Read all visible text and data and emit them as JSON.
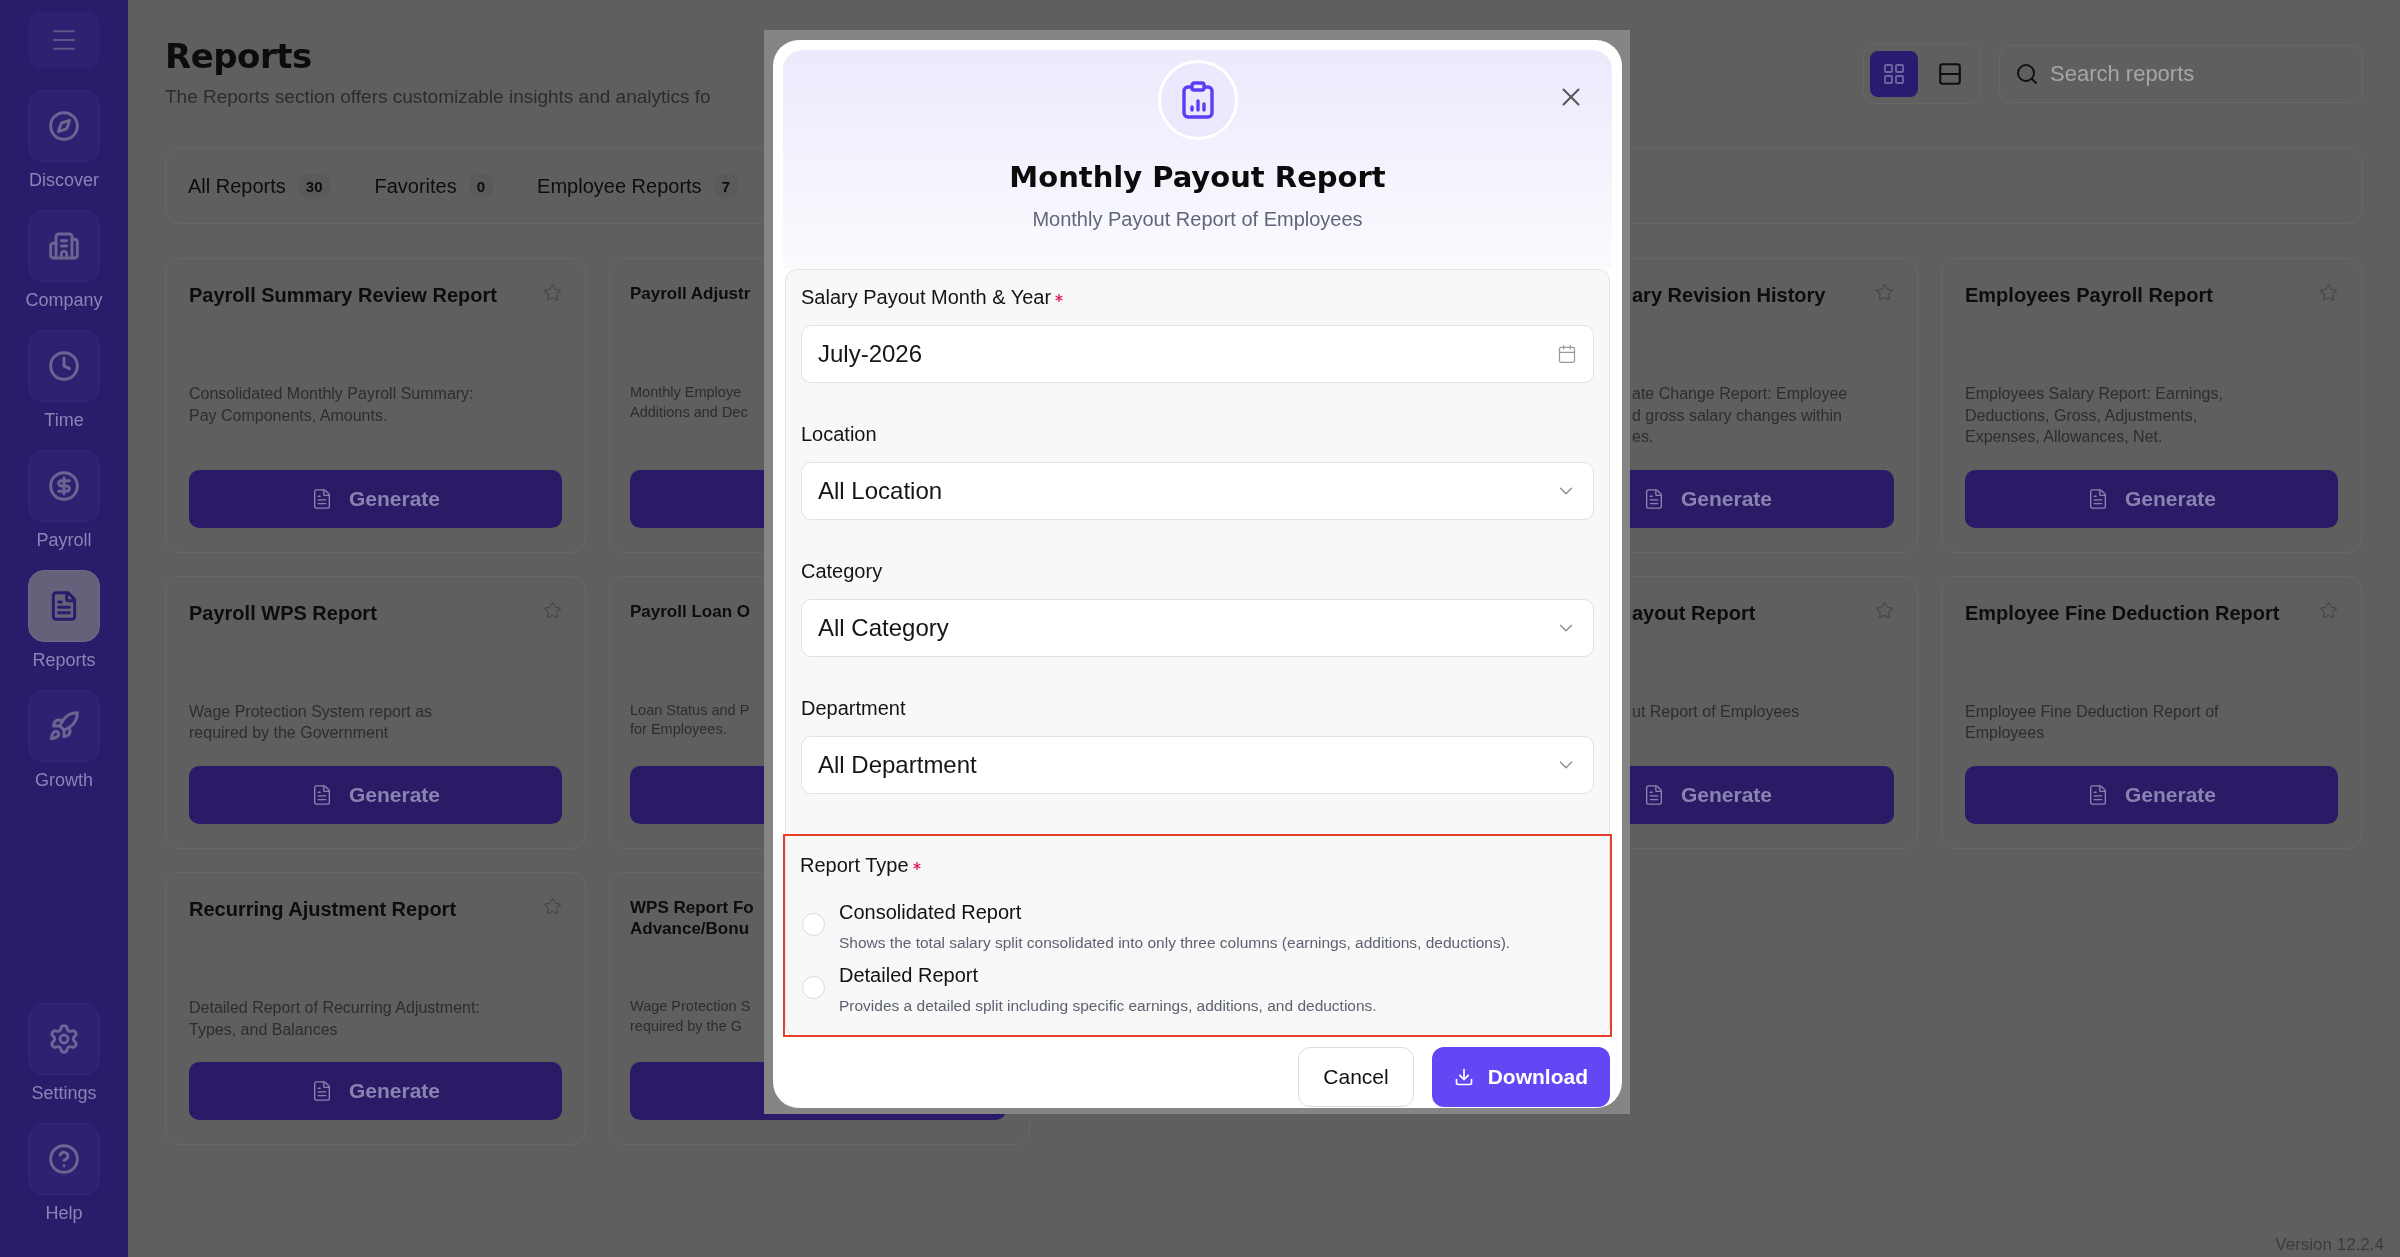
{
  "sidebar": {
    "items": [
      {
        "label": "Discover",
        "selected": false
      },
      {
        "label": "Company",
        "selected": false
      },
      {
        "label": "Time",
        "selected": false
      },
      {
        "label": "Payroll",
        "selected": false
      },
      {
        "label": "Reports",
        "selected": true
      },
      {
        "label": "Growth",
        "selected": false
      }
    ],
    "bottom_items": [
      {
        "label": "Settings",
        "selected": false
      },
      {
        "label": "Help",
        "selected": false
      }
    ]
  },
  "page": {
    "title": "Reports",
    "subtitle": "The Reports section offers customizable insights and analytics fo"
  },
  "view_toggle": [
    {
      "selected": true
    },
    {
      "selected": false
    }
  ],
  "search": {
    "placeholder": "Search reports"
  },
  "tabs": [
    {
      "label": "All Reports",
      "count": "30"
    },
    {
      "label": "Favorites",
      "count": "0"
    },
    {
      "label": "Employee Reports",
      "count": "7"
    }
  ],
  "card_rows": [
    {
      "cards": [
        {
          "title": "Payroll Summary Review Report",
          "description": "Consolidated Monthly Payroll Summary:\nPay Components, Amounts.",
          "button": "Generate"
        },
        {
          "title": "Payroll Adjustr",
          "description": "Monthly Employe\nAdditions and Dec"
        },
        {
          "title": "ary Revision History",
          "description": "ate Change Report: Employee\nd gross salary changes within\nes.",
          "button": "Generate"
        },
        {
          "title": "Employees Payroll Report",
          "description": "Employees Salary Report: Earnings,\nDeductions, Gross, Adjustments,\nExpenses, Allowances, Net.",
          "button": "Generate"
        }
      ]
    },
    {
      "cards": [
        {
          "title": "Payroll WPS Report",
          "description": "Wage Protection System report as\nrequired by the Government",
          "button": "Generate"
        },
        {
          "title": "Payroll Loan O",
          "description": "Loan Status and P\nfor Employees."
        },
        {
          "title": "ayout Report",
          "description": "ut Report of Employees",
          "button": "Generate"
        },
        {
          "title": "Employee Fine Deduction Report",
          "description": "Employee Fine Deduction Report of\nEmployees",
          "button": "Generate"
        }
      ]
    },
    {
      "cards": [
        {
          "title": "Recurring Ajustment Report",
          "description": "Detailed Report of Recurring Adjustment:\nTypes, and Balances",
          "button": "Generate"
        },
        {
          "title": "WPS Report Fo\nAdvance/Bonu",
          "description": "Wage Protection S\nrequired by the G"
        }
      ]
    }
  ],
  "modal": {
    "title": "Monthly Payout Report",
    "subtitle": "Monthly Payout Report of Employees",
    "fields": [
      {
        "label": "Salary Payout Month & Year",
        "required": true,
        "kind": "date",
        "value": "July-2026"
      },
      {
        "label": "Location",
        "required": false,
        "kind": "select",
        "value": "All Location"
      },
      {
        "label": "Category",
        "required": false,
        "kind": "select",
        "value": "All Category"
      },
      {
        "label": "Department",
        "required": false,
        "kind": "select",
        "value": "All Department"
      }
    ],
    "report_type": {
      "label": "Report Type",
      "required": true,
      "options": [
        {
          "title": "Consolidated Report",
          "description": "Shows the total salary split consolidated into only three columns (earnings, additions, deductions).",
          "selected": false
        },
        {
          "title": "Detailed Report",
          "description": "Provides a detailed split including specific earnings, additions, and deductions.",
          "selected": false
        }
      ]
    },
    "cancel": "Cancel",
    "download": "Download"
  },
  "version": "Version 12.2.4"
}
